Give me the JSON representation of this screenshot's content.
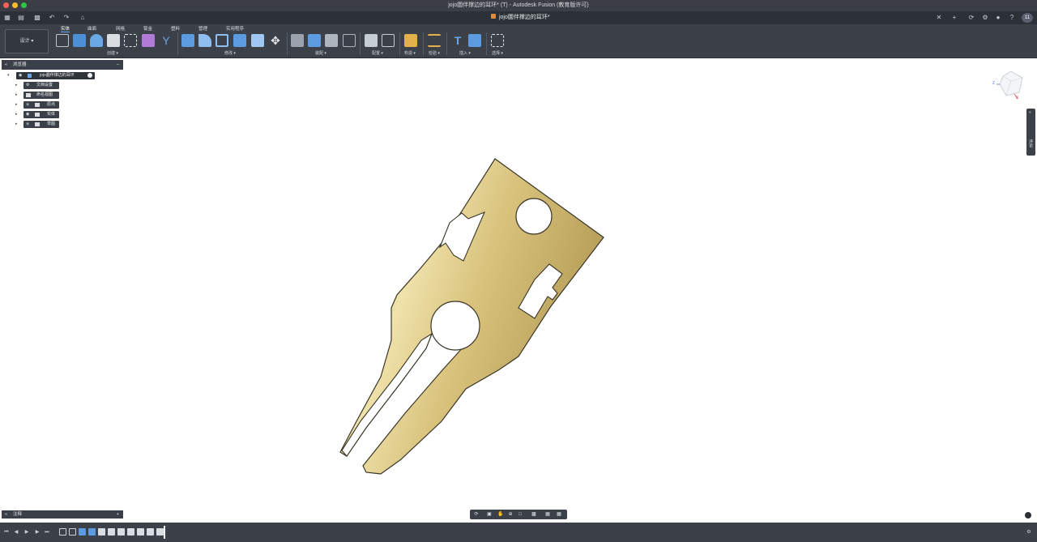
{
  "window": {
    "title": "jojo圜伴撑边的耳环* (T) - Autodesk Fusion (教育版许可)"
  },
  "tabbar": {
    "doc_tab": "jojo圜伴撑边的耳环*",
    "user_initials": "11"
  },
  "toolbar": {
    "workspace": "设计",
    "tabs": [
      "实体",
      "曲面",
      "网格",
      "钣金",
      "塑料",
      "管理",
      "实用程序"
    ],
    "groups": [
      "创建",
      "修改",
      "装配",
      "配置",
      "构造",
      "检验",
      "插入",
      "选择"
    ]
  },
  "browser": {
    "title": "浏览器",
    "root": "jojo圜伴撑边的耳环",
    "items": [
      "文档设置",
      "命名视图",
      "原点",
      "实体",
      "草图"
    ]
  },
  "annotations": {
    "title": "注释"
  },
  "viewcube": {
    "axes": [
      "Z",
      "X"
    ]
  },
  "sidepanel": {
    "label": "评论"
  },
  "colors": {
    "toolbar_bg": "#3c4149",
    "accent": "#5aa8ff",
    "model_gold": "#d8c27c"
  }
}
